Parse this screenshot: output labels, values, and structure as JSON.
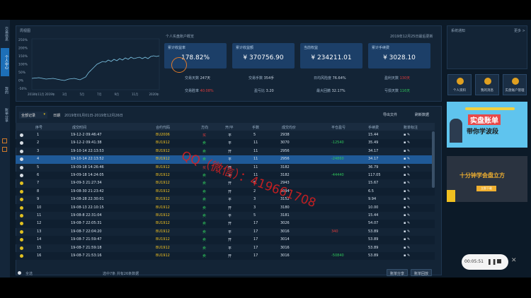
{
  "sidebar": {
    "tabs": [
      "交易信息",
      "个人中心",
      "我的",
      "账单分享"
    ]
  },
  "mini_chart": {
    "title": "周视图",
    "y_ticks": [
      "250%",
      "200%",
      "150%",
      "100%",
      "50%",
      "0%",
      "-50%"
    ],
    "x_ticks": [
      "2018年11月",
      "2019年",
      "3月",
      "5月",
      "7月",
      "9月",
      "11月",
      "2020年"
    ]
  },
  "overview": {
    "title": "个人实盘账户概览",
    "date": "2019年12月25日最后更新",
    "cards": [
      {
        "label": "累计收益率",
        "value": "178.82%"
      },
      {
        "label": "累计收益额",
        "value": "¥ 370756.90"
      },
      {
        "label": "当前权益",
        "value": "¥ 234211.01"
      },
      {
        "label": "累计手续费",
        "value": "¥ 3028.10"
      }
    ],
    "stats": [
      {
        "label": "交易天数",
        "value": "247天"
      },
      {
        "label": "交易手数",
        "value": "354手"
      },
      {
        "label": "日均风险度",
        "value": "76.64%"
      },
      {
        "label": "盈利天数",
        "value": "130天"
      },
      {
        "label": "交易胜率",
        "value": "40.08%"
      },
      {
        "label": "盈亏比",
        "value": "3.20"
      },
      {
        "label": "最大回撤",
        "value": "32.17%"
      },
      {
        "label": "亏损天数",
        "value": "116天"
      }
    ]
  },
  "filter": {
    "dropdown": "全部记录",
    "date_label": "日期",
    "date_range": "2019年01月01日-2019年12月26日",
    "export_btn": "导出文件",
    "refresh_btn": "刷新数据"
  },
  "table": {
    "headers": [
      "序号",
      "成交时间",
      "合约代码",
      "方向",
      "开/平",
      "手数",
      "成交均价",
      "平仓盈亏",
      "手续费",
      "账单标注"
    ],
    "rows": [
      [
        "1",
        "19-12-2 09:46:47",
        "BU2006",
        "买",
        "平",
        "5",
        "2938",
        "",
        "15.44"
      ],
      [
        "2",
        "19-12-2 09:41:38",
        "BU1912",
        "卖",
        "平",
        "11",
        "3070",
        "-12540",
        "35.49"
      ],
      [
        "3",
        "19-10-14 22:13:53",
        "BU1912",
        "卖",
        "开",
        "11",
        "2956",
        "",
        "34.17"
      ],
      [
        "4",
        "19-10-14 22:13:52",
        "BU1912",
        "卖",
        "平",
        "11",
        "2956",
        "-24860",
        "34.17"
      ],
      [
        "5",
        "19-09-18 14:26:46",
        "BU1912",
        "买",
        "开",
        "11",
        "3182",
        "",
        "36.79"
      ],
      [
        "6",
        "19-09-18 14:24:05",
        "BU1912",
        "卖",
        "平",
        "11",
        "3182",
        "-44440",
        "117.05"
      ],
      [
        "7",
        "19-09-3 21:27:34",
        "BU1912",
        "卖",
        "开",
        "5",
        "2943",
        "",
        "15.67"
      ],
      [
        "8",
        "19-08-30 21:23:42",
        "BU1912",
        "卖",
        "开",
        "2",
        "3094",
        "",
        "6.5"
      ],
      [
        "9",
        "19-08-28 22:30:01",
        "BU1912",
        "卖",
        "平",
        "3",
        "3152",
        "",
        "9.94"
      ],
      [
        "10",
        "19-08-13 22:10:15",
        "BU1912",
        "卖",
        "开",
        "3",
        "3180",
        "",
        "10.00"
      ],
      [
        "11",
        "19-08-8 22:31:04",
        "BU1912",
        "卖",
        "平",
        "5",
        "3181",
        "",
        "15.44"
      ],
      [
        "12",
        "19-08-7 22:05:31",
        "BU1912",
        "卖",
        "开",
        "17",
        "3026",
        "",
        "54.07"
      ],
      [
        "13",
        "19-08-7 22:04:20",
        "BU1912",
        "卖",
        "平",
        "17",
        "3016",
        "340",
        "53.89"
      ],
      [
        "14",
        "19-08-7 21:59:47",
        "BU1912",
        "卖",
        "开",
        "17",
        "3014",
        "",
        "53.89"
      ],
      [
        "15",
        "19-08-7 21:59:18",
        "BU1912",
        "卖",
        "平",
        "17",
        "3016",
        "",
        "53.89"
      ],
      [
        "16",
        "19-08-7 21:53:16",
        "BU1912",
        "卖",
        "开",
        "17",
        "3016",
        "-50840",
        "53.89"
      ]
    ],
    "footer_all": "全选",
    "footer_count": "选中7条 共有26条数据",
    "share_btn": "账单分享",
    "reply_btn": "账单回放"
  },
  "right_panel": {
    "title": "系统通知",
    "more": "更多 >",
    "buttons": [
      "个人资料",
      "我的消息",
      "实盘账户管理"
    ]
  },
  "ads": {
    "ad1_line1": "实盘账单",
    "ad1_line2": "带你学波段",
    "ad2_text": "十分钟学会盘立方",
    "ad2_btn": "立即下载"
  },
  "watermark": "QQ（微信）：419661708",
  "player": {
    "time": "00:05:51"
  }
}
